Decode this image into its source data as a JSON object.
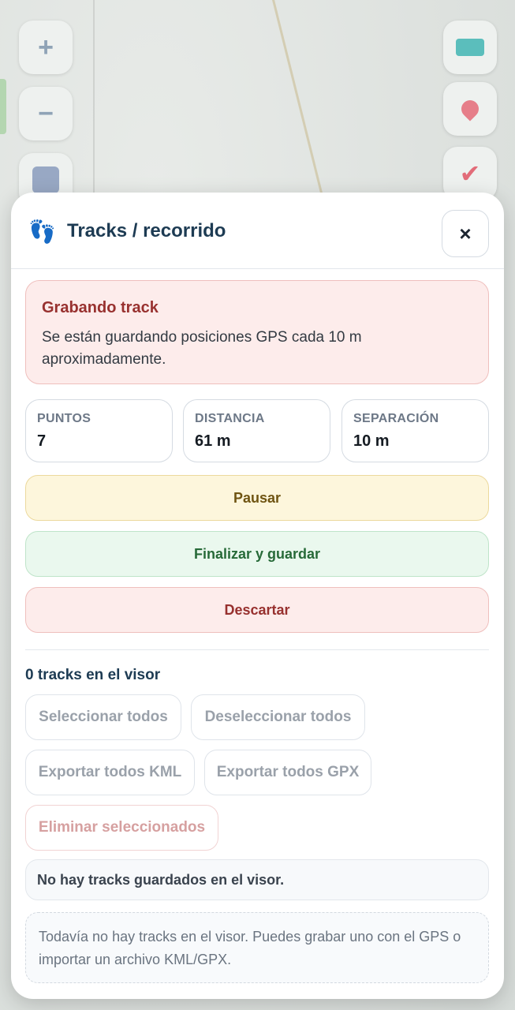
{
  "panel": {
    "title": "Tracks / recorrido",
    "close_label": "×"
  },
  "recording": {
    "title": "Grabando track",
    "text": "Se están guardando posiciones GPS cada 10 m aproximadamente."
  },
  "stats": [
    {
      "label": "PUNTOS",
      "value": "7"
    },
    {
      "label": "DISTANCIA",
      "value": "61 m"
    },
    {
      "label": "SEPARACIÓN",
      "value": "10 m"
    }
  ],
  "actions": {
    "pause": "Pausar",
    "finish": "Finalizar y guardar",
    "discard": "Descartar"
  },
  "tracks": {
    "count_title": "0 tracks en el visor",
    "select_all": "Seleccionar todos",
    "deselect_all": "Deseleccionar todos",
    "export_kml": "Exportar todos KML",
    "export_gpx": "Exportar todos GPX",
    "delete_selected": "Eliminar seleccionados",
    "empty_notice": "No hay tracks guardados en el visor.",
    "hint": "Todavía no hay tracks en el visor. Puedes grabar uno con el GPS o importar un archivo KML/GPX."
  },
  "map_controls": {
    "zoom_in": "+",
    "zoom_out": "−"
  },
  "colors": {
    "title": "#1d3b53",
    "alert_bg": "#fdeceb",
    "pause_bg": "#fdf6dc",
    "finish_bg": "#eaf8ee"
  }
}
